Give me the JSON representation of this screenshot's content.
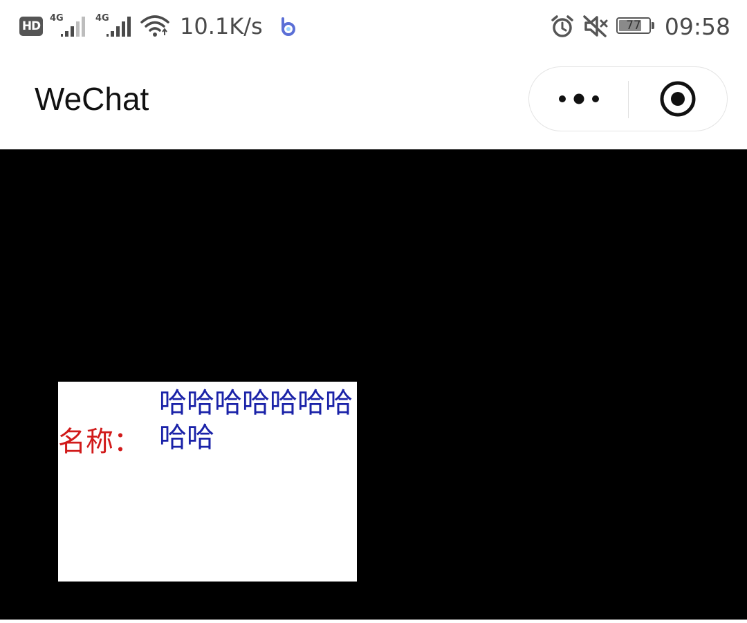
{
  "status_bar": {
    "hd_label": "HD",
    "sim1_label": "4G",
    "sim2_label": "4G",
    "network_speed": "10.1K/s",
    "battery_level": "77",
    "time": "09:58",
    "icons": [
      "hd-icon",
      "signal-icon",
      "wifi-icon",
      "app-b-icon",
      "alarm-icon",
      "mute-icon",
      "battery-icon"
    ]
  },
  "nav_bar": {
    "title": "WeChat",
    "icons": [
      "more-dots-icon",
      "close-target-icon"
    ]
  },
  "content": {
    "label": "名称：",
    "value": "哈哈哈哈哈哈哈哈哈"
  },
  "colors": {
    "label": "#d11a1a",
    "value": "#1a22a8",
    "page_background": "#000000",
    "card_background": "#ffffff"
  }
}
